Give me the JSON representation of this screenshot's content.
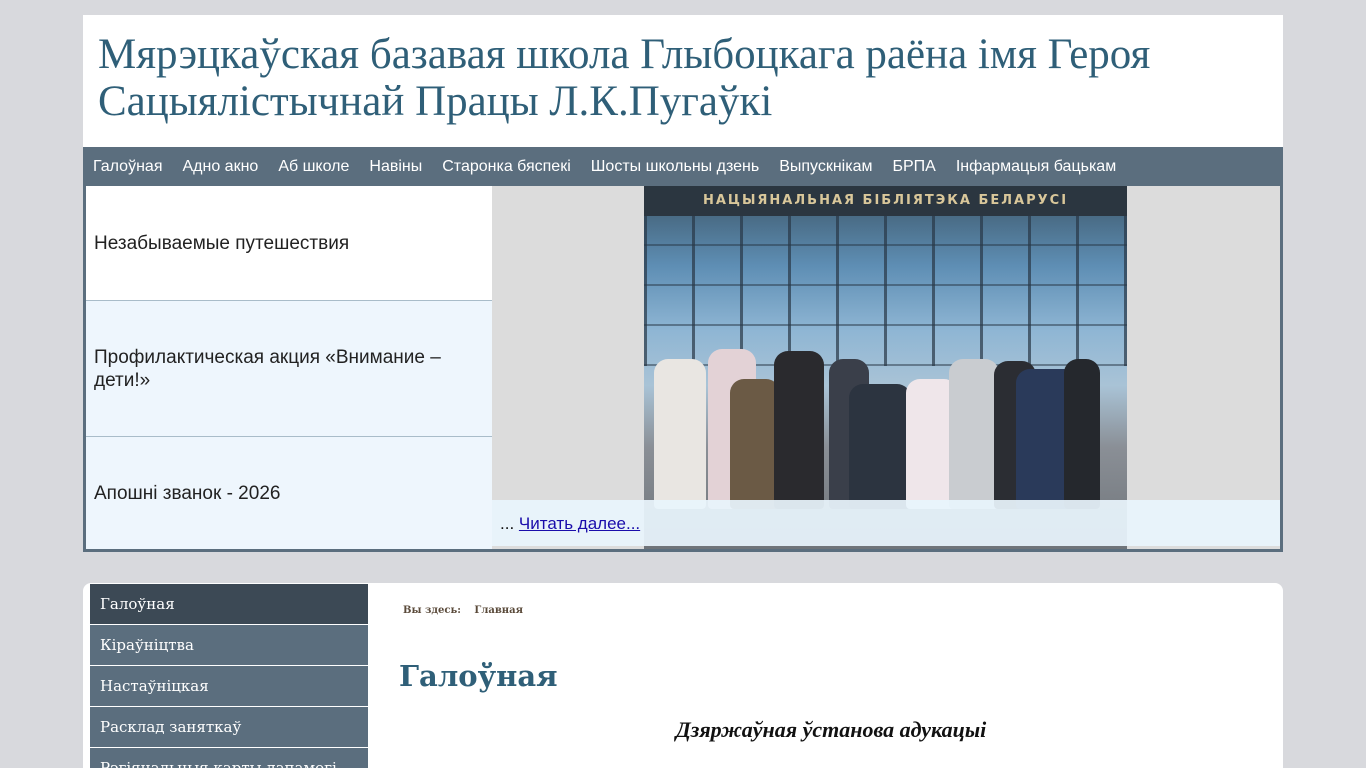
{
  "header": {
    "title": "Мярэцкаўская базавая школа Глыбоцкага раёна імя Героя Сацыялістычнай Працы Л.К.Пугаўкі"
  },
  "topnav": [
    {
      "label": "Галоўная"
    },
    {
      "label": "Адно акно"
    },
    {
      "label": "Аб школе"
    },
    {
      "label": "Навіны"
    },
    {
      "label": "Старонка бяспекі"
    },
    {
      "label": "Шосты школьны дзень"
    },
    {
      "label": "Выпускнікам"
    },
    {
      "label": "БРПА"
    },
    {
      "label": "Інфармацыя бацькам"
    }
  ],
  "slider": {
    "items": [
      {
        "label": "Незабываемые путешествия"
      },
      {
        "label": "Профилактическая акция «Внимание – дети!»"
      },
      {
        "label": "Апошні званок - 2026"
      }
    ],
    "photo_sign": "НАЦЫЯНАЛЬНАЯ БІБЛІЯТЭКА БЕЛАРУСІ",
    "readmore_prefix": "...",
    "readmore_link": "Читать далее..."
  },
  "sidebar": {
    "items": [
      {
        "label": "Галоўная"
      },
      {
        "label": "Кіраўніцтва"
      },
      {
        "label": "Настаўніцкая"
      },
      {
        "label": "Расклад заняткаў"
      },
      {
        "label": "Рэгіянальныя карты дапамогі"
      }
    ]
  },
  "breadcrumb": {
    "prefix": "Вы здесь:",
    "current": "Главная"
  },
  "content": {
    "title": "Галоўная",
    "subtitle": "Дзяржаўная ўстанова адукацыі"
  },
  "colors": {
    "nav_bg": "#5b6e7e",
    "title": "#2f5f78",
    "page_bg": "#d8d9dd"
  }
}
